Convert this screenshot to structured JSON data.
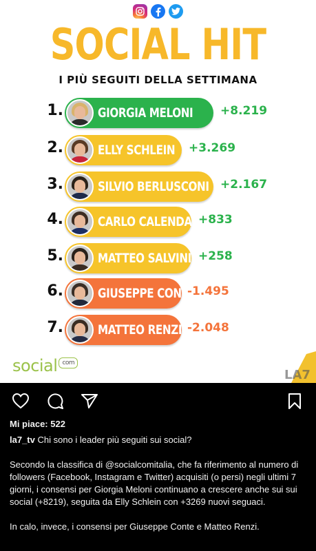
{
  "post": {
    "social_icons": [
      "instagram-icon",
      "facebook-icon",
      "twitter-icon"
    ],
    "title": "SOCIAL HIT",
    "subtitle": "I PIÙ SEGUITI DELLA SETTIMANA",
    "ranking": [
      {
        "rank": "1.",
        "name": "GIORGIA MELONI",
        "delta": "+8.219",
        "pill_color": "#2bb24c",
        "delta_color": "#2bb24c",
        "hair": "#d9b36c",
        "body": "#2a2a2a"
      },
      {
        "rank": "2.",
        "name": "ELLY SCHLEIN",
        "delta": "+3.269",
        "pill_color": "#f6c42a",
        "delta_color": "#2bb24c",
        "hair": "#5a3b25",
        "body": "#c9243a"
      },
      {
        "rank": "3.",
        "name": "SILVIO BERLUSCONI",
        "delta": "+2.167",
        "pill_color": "#f6c42a",
        "delta_color": "#2bb24c",
        "hair": "#2b2219",
        "body": "#1e2a4a"
      },
      {
        "rank": "4.",
        "name": "CARLO CALENDA",
        "delta": "+833",
        "pill_color": "#f6c42a",
        "delta_color": "#2bb24c",
        "hair": "#3d2d22",
        "body": "#1c2e63"
      },
      {
        "rank": "5.",
        "name": "MATTEO SALVINI",
        "delta": "+258",
        "pill_color": "#f6c42a",
        "delta_color": "#2bb24c",
        "hair": "#2a221b",
        "body": "#3b2d23"
      },
      {
        "rank": "6.",
        "name": "GIUSEPPE CONTE",
        "delta": "-1.495",
        "pill_color": "#f4743b",
        "delta_color": "#f4743b",
        "hair": "#3a2e26",
        "body": "#22283a"
      },
      {
        "rank": "7.",
        "name": "MATTEO RENZI",
        "delta": "-2.048",
        "pill_color": "#f4743b",
        "delta_color": "#f4743b",
        "hair": "#3a2d23",
        "body": "#252c45"
      }
    ],
    "footer_logo_left": {
      "text": "social",
      "badge": "com"
    },
    "footer_logo_right": "LA7"
  },
  "actions": {
    "like": "heart-icon",
    "comment": "comment-icon",
    "share": "share-icon",
    "save": "bookmark-icon"
  },
  "likes_label": "Mi piace: 522",
  "caption": {
    "username": "la7_tv",
    "first_line": "Chi sono i leader più seguiti sui social?",
    "paragraph_1": "Secondo la classifica di @socialcomitalia, che fa riferimento al numero di followers (Facebook, Instagram e Twitter) acquisiti (o persi) negli ultimi 7 giorni, i consensi per Giorgia Meloni continuano a crescere anche sui sui social (+8219), seguita da Elly Schlein con +3269 nuovi seguaci.",
    "paragraph_2": "In calo, invece, i consensi per Giuseppe Conte e Matteo Renzi."
  }
}
